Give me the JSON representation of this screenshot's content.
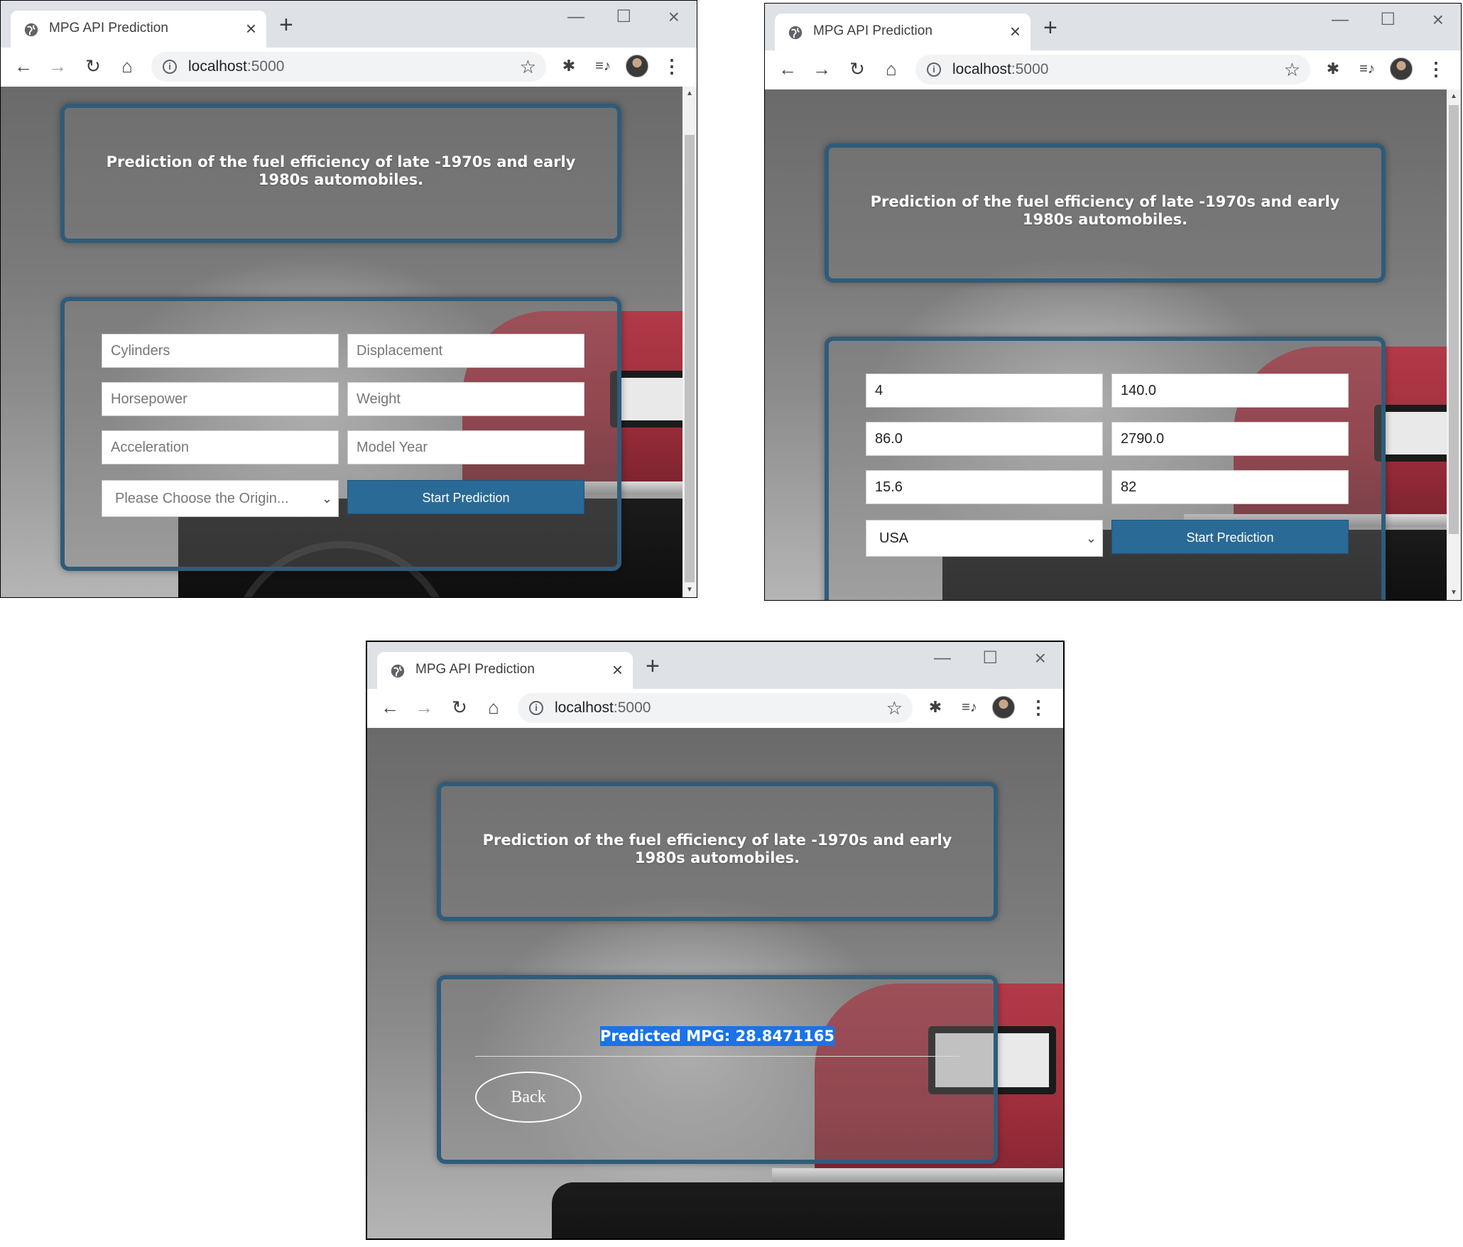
{
  "browser": {
    "tab_title": "MPG API Prediction",
    "new_tab": "+",
    "url_host": "localhost",
    "url_port": ":5000"
  },
  "page": {
    "title": "Prediction of the fuel efficiency of late -1970s and early 1980s automobiles."
  },
  "form_empty": {
    "cylinders_ph": "Cylinders",
    "displacement_ph": "Displacement",
    "horsepower_ph": "Horsepower",
    "weight_ph": "Weight",
    "acceleration_ph": "Acceleration",
    "model_year_ph": "Model Year",
    "origin_ph": "Please Choose the Origin...",
    "submit": "Start Prediction"
  },
  "form_filled": {
    "cylinders": "4",
    "displacement": "140.0",
    "horsepower": "86.0",
    "weight": "2790.0",
    "acceleration": "15.6",
    "model_year": "82",
    "origin": "USA",
    "submit": "Start Prediction"
  },
  "result": {
    "text": "Predicted MPG: 28.8471165",
    "back": "Back"
  },
  "colors": {
    "panel_border": "#2f5c7a",
    "button": "#2a6a96",
    "highlight": "#1a73e8",
    "car_red": "#b23a48"
  },
  "icons": [
    "globe-icon",
    "close-icon",
    "plus-icon",
    "minimize-icon",
    "maximize-icon",
    "back-arrow-icon",
    "forward-arrow-icon",
    "reload-icon",
    "home-icon",
    "info-icon",
    "star-icon",
    "puzzle-icon",
    "media-icon",
    "avatar",
    "kebab-menu-icon",
    "chevron-down-icon"
  ]
}
